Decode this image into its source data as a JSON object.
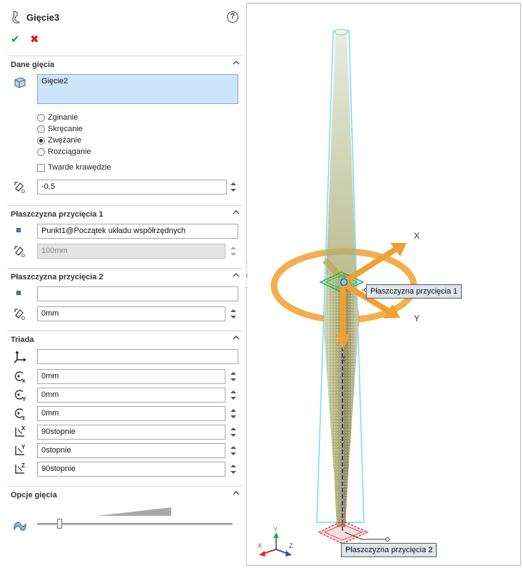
{
  "feature": {
    "title": "Gięcie3",
    "help_label": "?",
    "ok_label": "✔",
    "cancel_label": "✖"
  },
  "dane_giecia": {
    "header": "Dane gięcia",
    "body_selection": "Gięcie2",
    "options": [
      {
        "label": "Zginanie",
        "selected": false
      },
      {
        "label": "Skręcanie",
        "selected": false
      },
      {
        "label": "Zwężanie",
        "selected": true
      },
      {
        "label": "Rozciąganie",
        "selected": false
      }
    ],
    "hard_edges_label": "Twarde krawędzie",
    "hard_edges_checked": false,
    "factor_value": "-0.5"
  },
  "trim_plane_1": {
    "header": "Płaszczyzna przycięcia 1",
    "reference": "Punkt1@Początek układu współrzędnych",
    "offset": "100mm"
  },
  "trim_plane_2": {
    "header": "Płaszczyzna przycięcia 2",
    "reference": "",
    "offset": "0mm"
  },
  "triad": {
    "header": "Triada",
    "reference": "",
    "x": "0mm",
    "y": "0mm",
    "z": "0mm",
    "rot_x": "90stopnie",
    "rot_y": "0stopnie",
    "rot_z": "90stopnie"
  },
  "bend_options": {
    "header": "Opcje gięcia",
    "accuracy": 0.1
  },
  "viewport": {
    "callout_1": "Płaszczyzna przycięcia 1",
    "callout_2": "Płaszczyzna przycięcia 2",
    "axis_x": "X",
    "axis_y": "Y",
    "axis_z": "Z",
    "icons": [
      "x-axis-arrow",
      "y-axis-arrow",
      "z-axis-arrow",
      "rotation-ring"
    ]
  },
  "colors": {
    "accent_selection": "#cde4fa",
    "triad_orange": "#f0a030",
    "plane1_green": "#2fa24a",
    "plane2_red": "#d8262a",
    "body_tint": "#b9b87a"
  }
}
